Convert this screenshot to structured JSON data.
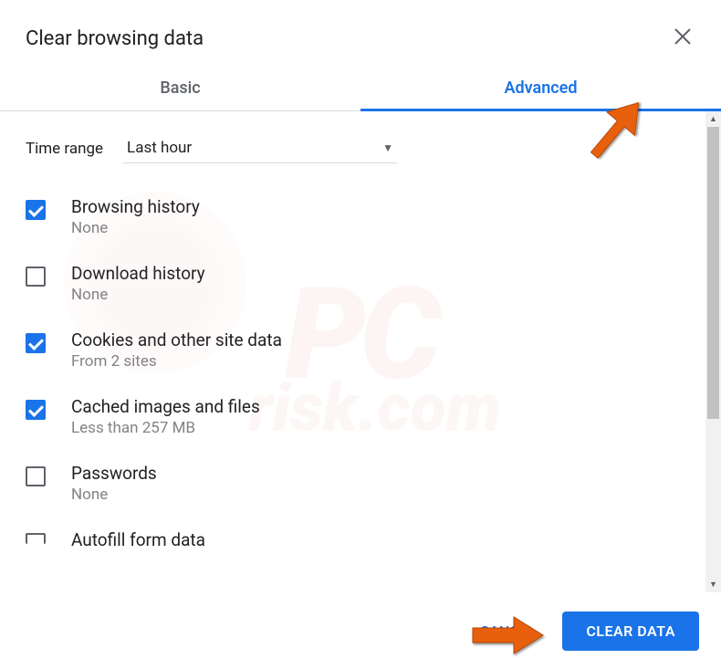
{
  "dialog": {
    "title": "Clear browsing data"
  },
  "tabs": {
    "basic": "Basic",
    "advanced": "Advanced"
  },
  "timeRange": {
    "label": "Time range",
    "value": "Last hour"
  },
  "items": [
    {
      "title": "Browsing history",
      "subtitle": "None",
      "checked": true
    },
    {
      "title": "Download history",
      "subtitle": "None",
      "checked": false
    },
    {
      "title": "Cookies and other site data",
      "subtitle": "From 2 sites",
      "checked": true
    },
    {
      "title": "Cached images and files",
      "subtitle": "Less than 257 MB",
      "checked": true
    },
    {
      "title": "Passwords",
      "subtitle": "None",
      "checked": false
    },
    {
      "title": "Autofill form data",
      "subtitle": "",
      "checked": false
    }
  ],
  "footer": {
    "cancel": "CANCEL",
    "clear": "CLEAR DATA"
  },
  "annotations": {
    "arrowColor": "#E8610F"
  }
}
